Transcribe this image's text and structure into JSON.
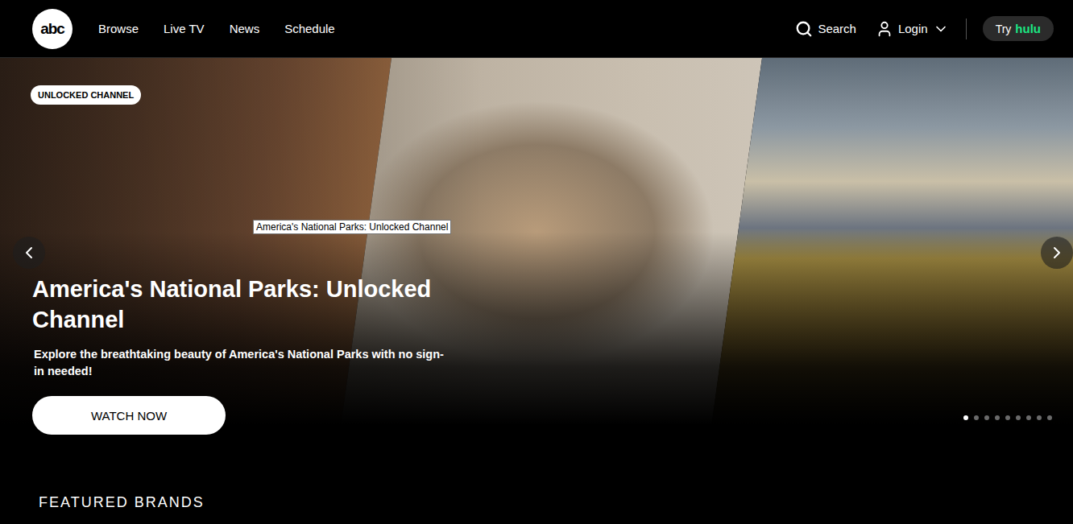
{
  "header": {
    "logo": "abc",
    "nav": [
      {
        "label": "Browse"
      },
      {
        "label": "Live TV"
      },
      {
        "label": "News"
      },
      {
        "label": "Schedule"
      }
    ],
    "search": "Search",
    "login": "Login",
    "hulu_button": {
      "prefix": "Try",
      "brand": "hulu"
    }
  },
  "hero": {
    "badge": "UNLOCKED CHANNEL",
    "title": "America's National Parks: Unlocked Channel",
    "description": "Explore the breathtaking beauty of America's National Parks with no sign-in needed!",
    "button": "WATCH NOW",
    "tooltip": "America's National Parks: Unlocked Channel",
    "dots": [
      {
        "selected": true
      },
      {
        "selected": false
      },
      {
        "selected": false
      },
      {
        "selected": false
      },
      {
        "selected": false
      },
      {
        "selected": false
      },
      {
        "selected": false
      },
      {
        "selected": false
      },
      {
        "selected": false
      }
    ]
  },
  "featured": {
    "heading": "FEATURED BRANDS"
  }
}
